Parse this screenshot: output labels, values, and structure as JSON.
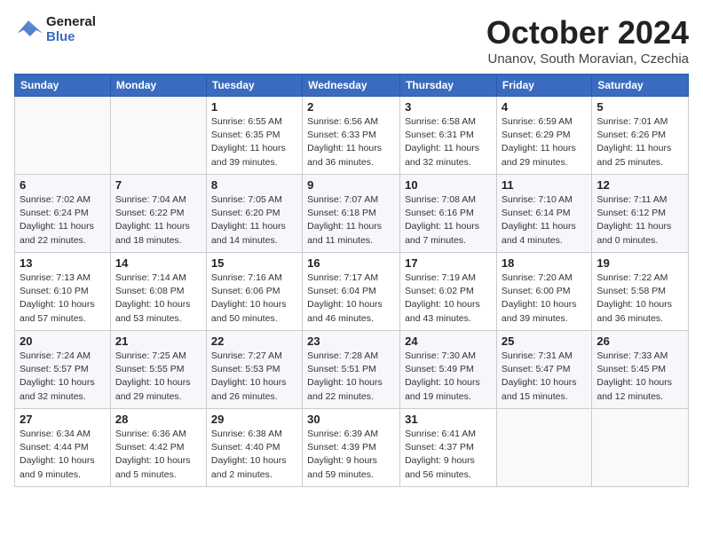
{
  "header": {
    "logo_line1": "General",
    "logo_line2": "Blue",
    "month": "October 2024",
    "location": "Unanov, South Moravian, Czechia"
  },
  "weekdays": [
    "Sunday",
    "Monday",
    "Tuesday",
    "Wednesday",
    "Thursday",
    "Friday",
    "Saturday"
  ],
  "weeks": [
    [
      {
        "day": "",
        "info": ""
      },
      {
        "day": "",
        "info": ""
      },
      {
        "day": "1",
        "info": "Sunrise: 6:55 AM\nSunset: 6:35 PM\nDaylight: 11 hours\nand 39 minutes."
      },
      {
        "day": "2",
        "info": "Sunrise: 6:56 AM\nSunset: 6:33 PM\nDaylight: 11 hours\nand 36 minutes."
      },
      {
        "day": "3",
        "info": "Sunrise: 6:58 AM\nSunset: 6:31 PM\nDaylight: 11 hours\nand 32 minutes."
      },
      {
        "day": "4",
        "info": "Sunrise: 6:59 AM\nSunset: 6:29 PM\nDaylight: 11 hours\nand 29 minutes."
      },
      {
        "day": "5",
        "info": "Sunrise: 7:01 AM\nSunset: 6:26 PM\nDaylight: 11 hours\nand 25 minutes."
      }
    ],
    [
      {
        "day": "6",
        "info": "Sunrise: 7:02 AM\nSunset: 6:24 PM\nDaylight: 11 hours\nand 22 minutes."
      },
      {
        "day": "7",
        "info": "Sunrise: 7:04 AM\nSunset: 6:22 PM\nDaylight: 11 hours\nand 18 minutes."
      },
      {
        "day": "8",
        "info": "Sunrise: 7:05 AM\nSunset: 6:20 PM\nDaylight: 11 hours\nand 14 minutes."
      },
      {
        "day": "9",
        "info": "Sunrise: 7:07 AM\nSunset: 6:18 PM\nDaylight: 11 hours\nand 11 minutes."
      },
      {
        "day": "10",
        "info": "Sunrise: 7:08 AM\nSunset: 6:16 PM\nDaylight: 11 hours\nand 7 minutes."
      },
      {
        "day": "11",
        "info": "Sunrise: 7:10 AM\nSunset: 6:14 PM\nDaylight: 11 hours\nand 4 minutes."
      },
      {
        "day": "12",
        "info": "Sunrise: 7:11 AM\nSunset: 6:12 PM\nDaylight: 11 hours\nand 0 minutes."
      }
    ],
    [
      {
        "day": "13",
        "info": "Sunrise: 7:13 AM\nSunset: 6:10 PM\nDaylight: 10 hours\nand 57 minutes."
      },
      {
        "day": "14",
        "info": "Sunrise: 7:14 AM\nSunset: 6:08 PM\nDaylight: 10 hours\nand 53 minutes."
      },
      {
        "day": "15",
        "info": "Sunrise: 7:16 AM\nSunset: 6:06 PM\nDaylight: 10 hours\nand 50 minutes."
      },
      {
        "day": "16",
        "info": "Sunrise: 7:17 AM\nSunset: 6:04 PM\nDaylight: 10 hours\nand 46 minutes."
      },
      {
        "day": "17",
        "info": "Sunrise: 7:19 AM\nSunset: 6:02 PM\nDaylight: 10 hours\nand 43 minutes."
      },
      {
        "day": "18",
        "info": "Sunrise: 7:20 AM\nSunset: 6:00 PM\nDaylight: 10 hours\nand 39 minutes."
      },
      {
        "day": "19",
        "info": "Sunrise: 7:22 AM\nSunset: 5:58 PM\nDaylight: 10 hours\nand 36 minutes."
      }
    ],
    [
      {
        "day": "20",
        "info": "Sunrise: 7:24 AM\nSunset: 5:57 PM\nDaylight: 10 hours\nand 32 minutes."
      },
      {
        "day": "21",
        "info": "Sunrise: 7:25 AM\nSunset: 5:55 PM\nDaylight: 10 hours\nand 29 minutes."
      },
      {
        "day": "22",
        "info": "Sunrise: 7:27 AM\nSunset: 5:53 PM\nDaylight: 10 hours\nand 26 minutes."
      },
      {
        "day": "23",
        "info": "Sunrise: 7:28 AM\nSunset: 5:51 PM\nDaylight: 10 hours\nand 22 minutes."
      },
      {
        "day": "24",
        "info": "Sunrise: 7:30 AM\nSunset: 5:49 PM\nDaylight: 10 hours\nand 19 minutes."
      },
      {
        "day": "25",
        "info": "Sunrise: 7:31 AM\nSunset: 5:47 PM\nDaylight: 10 hours\nand 15 minutes."
      },
      {
        "day": "26",
        "info": "Sunrise: 7:33 AM\nSunset: 5:45 PM\nDaylight: 10 hours\nand 12 minutes."
      }
    ],
    [
      {
        "day": "27",
        "info": "Sunrise: 6:34 AM\nSunset: 4:44 PM\nDaylight: 10 hours\nand 9 minutes."
      },
      {
        "day": "28",
        "info": "Sunrise: 6:36 AM\nSunset: 4:42 PM\nDaylight: 10 hours\nand 5 minutes."
      },
      {
        "day": "29",
        "info": "Sunrise: 6:38 AM\nSunset: 4:40 PM\nDaylight: 10 hours\nand 2 minutes."
      },
      {
        "day": "30",
        "info": "Sunrise: 6:39 AM\nSunset: 4:39 PM\nDaylight: 9 hours\nand 59 minutes."
      },
      {
        "day": "31",
        "info": "Sunrise: 6:41 AM\nSunset: 4:37 PM\nDaylight: 9 hours\nand 56 minutes."
      },
      {
        "day": "",
        "info": ""
      },
      {
        "day": "",
        "info": ""
      }
    ]
  ]
}
